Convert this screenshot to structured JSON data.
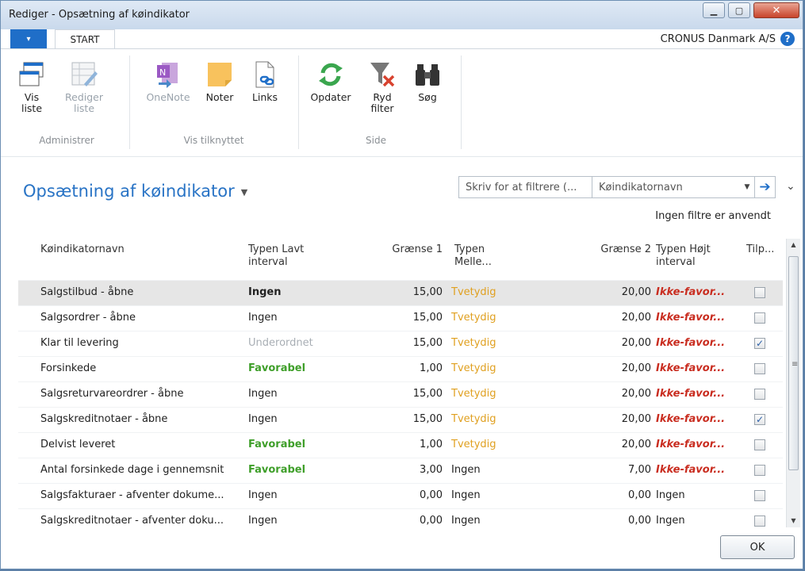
{
  "window": {
    "title": "Rediger - Opsætning af køindikator"
  },
  "tabs": {
    "menu_icon": "▾",
    "start": "START",
    "company": "CRONUS Danmark A/S",
    "help": "?"
  },
  "ribbon": {
    "administrer": {
      "label": "Administrer",
      "vis_liste": "Vis\nliste",
      "rediger_liste": "Rediger\nliste"
    },
    "vis_tilknyttet": {
      "label": "Vis tilknyttet",
      "onenote": "OneNote",
      "noter": "Noter",
      "links": "Links"
    },
    "side": {
      "label": "Side",
      "opdater": "Opdater",
      "ryd_filter": "Ryd\nfilter",
      "sog": "Søg"
    }
  },
  "page": {
    "title": "Opsætning af køindikator",
    "no_filters": "Ingen filtre er anvendt"
  },
  "filter": {
    "placeholder": "Skriv for at filtrere (...",
    "field": "Køindikatornavn"
  },
  "columns": {
    "name": "Køindikatornavn",
    "low": "Typen Lavt\ninterval",
    "g1": "Grænse 1",
    "mid": "Typen\nMelle...",
    "g2": "Grænse 2",
    "high": "Typen Højt\ninterval",
    "tilp": "Tilp..."
  },
  "rows": [
    {
      "name": "Salgstilbud - åbne",
      "low": "Ingen",
      "low_type": "bold",
      "g1": "15,00",
      "mid": "Tvetydig",
      "mid_type": "tvet",
      "g2": "20,00",
      "high": "Ikke-favor...",
      "high_type": "ikke",
      "checked": false
    },
    {
      "name": "Salgsordrer - åbne",
      "low": "Ingen",
      "low_type": "plain",
      "g1": "15,00",
      "mid": "Tvetydig",
      "mid_type": "tvet",
      "g2": "20,00",
      "high": "Ikke-favor...",
      "high_type": "ikke",
      "checked": false
    },
    {
      "name": "Klar til levering",
      "low": "Underordnet",
      "low_type": "under",
      "g1": "15,00",
      "mid": "Tvetydig",
      "mid_type": "tvet",
      "g2": "20,00",
      "high": "Ikke-favor...",
      "high_type": "ikke",
      "checked": true
    },
    {
      "name": "Forsinkede",
      "low": "Favorabel",
      "low_type": "favor",
      "g1": "1,00",
      "mid": "Tvetydig",
      "mid_type": "tvet",
      "g2": "20,00",
      "high": "Ikke-favor...",
      "high_type": "ikke",
      "checked": false
    },
    {
      "name": "Salgsreturvareordrer - åbne",
      "low": "Ingen",
      "low_type": "plain",
      "g1": "15,00",
      "mid": "Tvetydig",
      "mid_type": "tvet",
      "g2": "20,00",
      "high": "Ikke-favor...",
      "high_type": "ikke",
      "checked": false
    },
    {
      "name": "Salgskreditnotaer - åbne",
      "low": "Ingen",
      "low_type": "plain",
      "g1": "15,00",
      "mid": "Tvetydig",
      "mid_type": "tvet",
      "g2": "20,00",
      "high": "Ikke-favor...",
      "high_type": "ikke",
      "checked": true
    },
    {
      "name": "Delvist leveret",
      "low": "Favorabel",
      "low_type": "favor",
      "g1": "1,00",
      "mid": "Tvetydig",
      "mid_type": "tvet",
      "g2": "20,00",
      "high": "Ikke-favor...",
      "high_type": "ikke",
      "checked": false
    },
    {
      "name": "Antal forsinkede dage i gennemsnit",
      "low": "Favorabel",
      "low_type": "favor",
      "g1": "3,00",
      "mid": "Ingen",
      "mid_type": "plain",
      "g2": "7,00",
      "high": "Ikke-favor...",
      "high_type": "ikke",
      "checked": false
    },
    {
      "name": "Salgsfakturaer - afventer dokume...",
      "low": "Ingen",
      "low_type": "plain",
      "g1": "0,00",
      "mid": "Ingen",
      "mid_type": "plain",
      "g2": "0,00",
      "high": "Ingen",
      "high_type": "plain",
      "checked": false
    },
    {
      "name": "Salgskreditnotaer - afventer doku...",
      "low": "Ingen",
      "low_type": "plain",
      "g1": "0,00",
      "mid": "Ingen",
      "mid_type": "plain",
      "g2": "0,00",
      "high": "Ingen",
      "high_type": "plain",
      "checked": false
    }
  ],
  "footer": {
    "ok": "OK"
  },
  "colors": {
    "accent": "#2873c5",
    "favor": "#3f9f2a",
    "tvetydig": "#e0a020",
    "ikke": "#c92d20"
  }
}
